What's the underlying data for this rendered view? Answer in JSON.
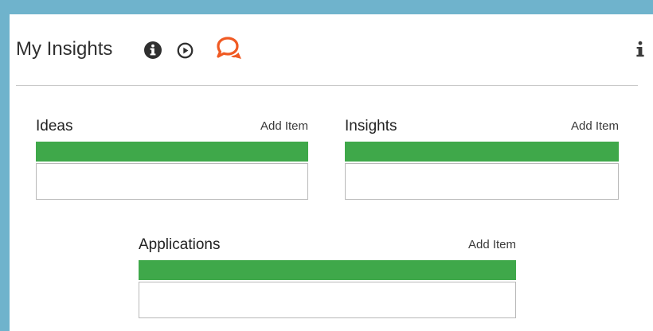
{
  "header": {
    "title": "My Insights",
    "icons": [
      "info-circle-icon",
      "play-circle-icon",
      "chat-bubbles-icon",
      "info-icon"
    ]
  },
  "sections": [
    {
      "title": "Ideas",
      "add_label": "Add Item",
      "bar_color": "#3fa84a"
    },
    {
      "title": "Insights",
      "add_label": "Add Item",
      "bar_color": "#3fa84a"
    },
    {
      "title": "Applications",
      "add_label": "Add Item",
      "bar_color": "#3fa84a"
    }
  ],
  "colors": {
    "frame": "#6fb3cc",
    "accent_green": "#3fa84a",
    "chat_icon": "#f05a23"
  }
}
